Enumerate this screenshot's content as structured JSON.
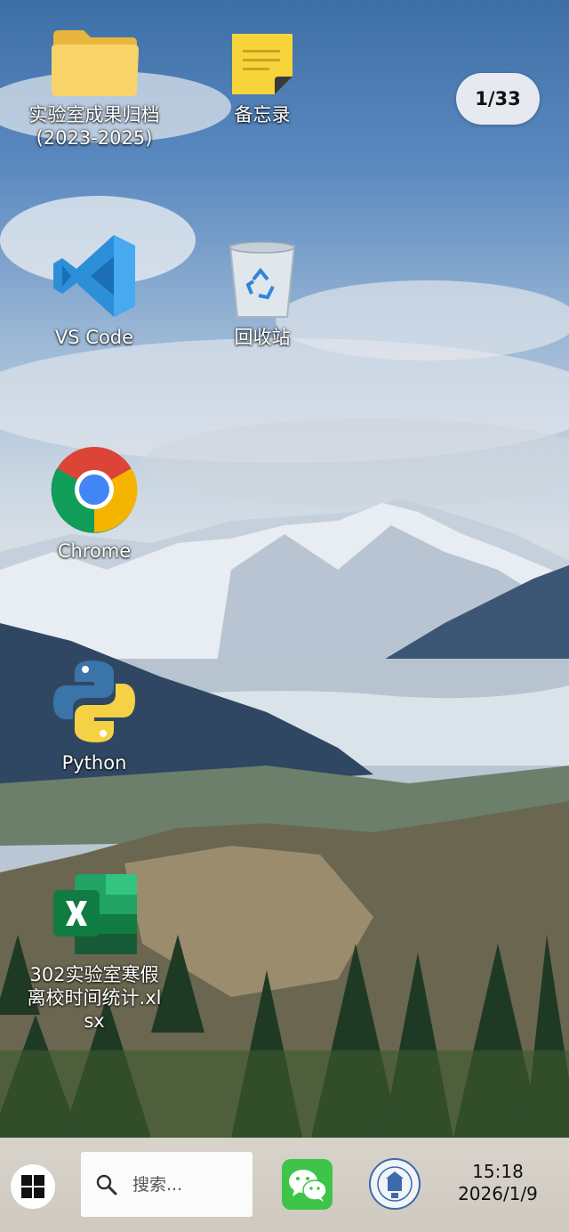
{
  "desktop": {
    "page_indicator": "1/33",
    "icons": [
      {
        "label": "实验室成果归档(2023-2025)",
        "icon": "folder-icon"
      },
      {
        "label": "备忘录",
        "icon": "sticky-note-icon"
      },
      {
        "label": "VS Code",
        "icon": "vscode-icon"
      },
      {
        "label": "回收站",
        "icon": "recycle-bin-icon"
      },
      {
        "label": "Chrome",
        "icon": "chrome-icon"
      },
      {
        "label": "Python",
        "icon": "python-icon"
      },
      {
        "label": "302实验室寒假离校时间统计.xlsx",
        "icon": "excel-icon"
      }
    ]
  },
  "taskbar": {
    "search_placeholder": "搜索...",
    "time": "15:18",
    "date": "2026/1/9"
  }
}
